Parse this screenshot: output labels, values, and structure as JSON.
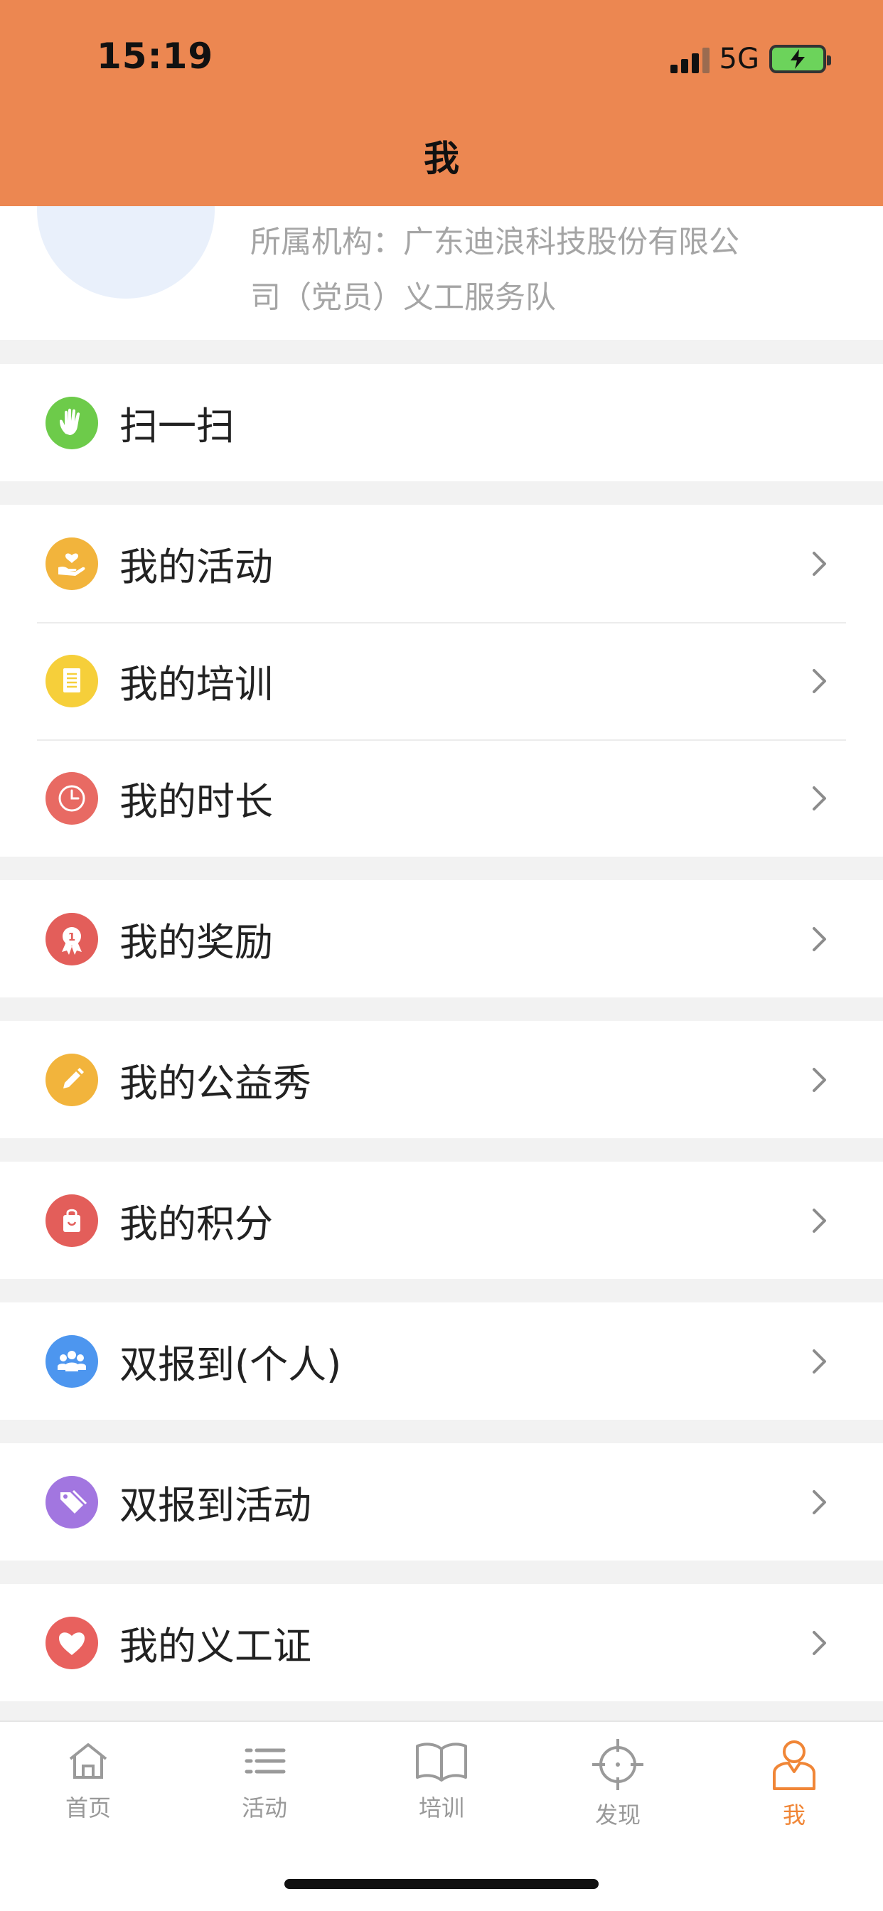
{
  "status": {
    "time": "15:19",
    "network": "5G"
  },
  "header": {
    "title": "我"
  },
  "profile": {
    "org": "所属机构：广东迪浪科技股份有限公司（党员）义工服务队"
  },
  "menu": {
    "scan": "扫一扫",
    "activities": "我的活动",
    "training": "我的培训",
    "hours": "我的时长",
    "rewards": "我的奖励",
    "charity_show": "我的公益秀",
    "points": "我的积分",
    "dual_report_personal": "双报到(个人)",
    "dual_report_activity": "双报到活动",
    "volunteer_card": "我的义工证"
  },
  "icons": {
    "scan": "hand-icon",
    "activities": "heart-hand-icon",
    "training": "document-icon",
    "hours": "clock-icon",
    "rewards": "medal-icon",
    "charity_show": "pencil-icon",
    "points": "shopping-bag-icon",
    "dual_report_personal": "group-icon",
    "dual_report_activity": "tag-icon",
    "volunteer_card": "heart-icon"
  },
  "colors": {
    "header": "#ec8751",
    "scan": "#6dcb4a",
    "activities": "#f2b43c",
    "training": "#f6cf3a",
    "hours": "#e86a63",
    "rewards": "#e35e5a",
    "charity_show": "#f2b43c",
    "points": "#e35e5a",
    "dual_report_personal": "#4d96ef",
    "dual_report_activity": "#a276e0",
    "volunteer_card": "#e8615e",
    "tab_active": "#f08637"
  },
  "tabs": {
    "home": "首页",
    "activities": "活动",
    "training": "培训",
    "discover": "发现",
    "me": "我"
  }
}
